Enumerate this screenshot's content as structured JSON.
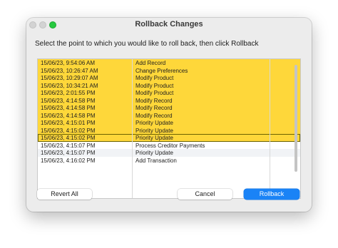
{
  "window": {
    "title": "Rollback Changes"
  },
  "instruction": "Select the point to which you would like to roll back, then click Rollback",
  "rows": [
    {
      "timestamp": "15/06/23, 9:54:06 AM",
      "action": "Add Record",
      "highlighted": true
    },
    {
      "timestamp": "15/06/23, 10:26:47 AM",
      "action": "Change Preferences",
      "highlighted": true
    },
    {
      "timestamp": "15/06/23, 10:29:07 AM",
      "action": "Modify Product",
      "highlighted": true
    },
    {
      "timestamp": "15/06/23, 10:34:21 AM",
      "action": "Modify Product",
      "highlighted": true
    },
    {
      "timestamp": "15/06/23, 2:01:55 PM",
      "action": "Modify Product",
      "highlighted": true
    },
    {
      "timestamp": "15/06/23, 4:14:58 PM",
      "action": "Modify Record",
      "highlighted": true
    },
    {
      "timestamp": "15/06/23, 4:14:58 PM",
      "action": "Modify Record",
      "highlighted": true
    },
    {
      "timestamp": "15/06/23, 4:14:58 PM",
      "action": "Modify Record",
      "highlighted": true
    },
    {
      "timestamp": "15/06/23, 4:15:01 PM",
      "action": "Priority Update",
      "highlighted": true
    },
    {
      "timestamp": "15/06/23, 4:15:02 PM",
      "action": "Priority Update",
      "highlighted": true
    },
    {
      "timestamp": "15/06/23, 4:15:02 PM",
      "action": "Priority Update",
      "highlighted": true,
      "selected": true
    },
    {
      "timestamp": "15/06/23, 4:15:07 PM",
      "action": "Process Creditor Payments",
      "highlighted": false
    },
    {
      "timestamp": "15/06/23, 4:15:07 PM",
      "action": "Priority Update",
      "highlighted": false
    },
    {
      "timestamp": "15/06/23, 4:16:02 PM",
      "action": "Add Transaction",
      "highlighted": false
    }
  ],
  "buttons": {
    "revert_all": "Revert All",
    "cancel": "Cancel",
    "rollback": "Rollback"
  },
  "colors": {
    "highlight": "#fed73a",
    "accent": "#1a83f6",
    "zoom": "#27c93f"
  }
}
